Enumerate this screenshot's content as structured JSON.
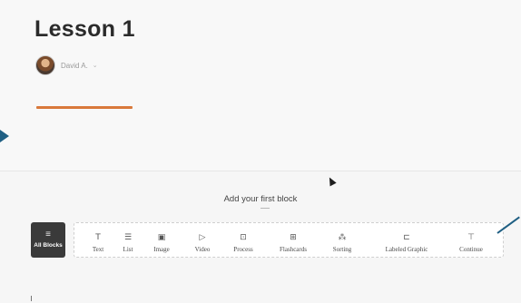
{
  "lesson": {
    "title": "Lesson 1",
    "author": "David A.",
    "author_caret": "⌄"
  },
  "add_block": {
    "prompt": "Add your first block"
  },
  "all_blocks": {
    "icon": "≡",
    "icon_name": "menu-lines-icon",
    "label": "All Blocks"
  },
  "blocks": [
    {
      "label": "Text",
      "icon": "T",
      "icon_name": "text-icon"
    },
    {
      "label": "List",
      "icon": "☰",
      "icon_name": "list-icon"
    },
    {
      "label": "Image",
      "icon": "▣",
      "icon_name": "image-icon"
    },
    {
      "label": "Video",
      "icon": "▷",
      "icon_name": "video-icon"
    },
    {
      "label": "Process",
      "icon": "⊡",
      "icon_name": "process-icon"
    },
    {
      "label": "Flashcards",
      "icon": "⊞",
      "icon_name": "flashcards-icon"
    },
    {
      "label": "Sorting",
      "icon": "⁂",
      "icon_name": "sorting-icon"
    },
    {
      "label": "Labeled Graphic",
      "icon": "⊏",
      "icon_name": "labeled-graphic-icon"
    },
    {
      "label": "Continue",
      "icon": "⊤",
      "icon_name": "continue-icon"
    }
  ],
  "colors": {
    "accent": "#d9793b",
    "annotation_arrow": "#1f5f83",
    "all_blocks_bg": "#3a3a3a"
  }
}
